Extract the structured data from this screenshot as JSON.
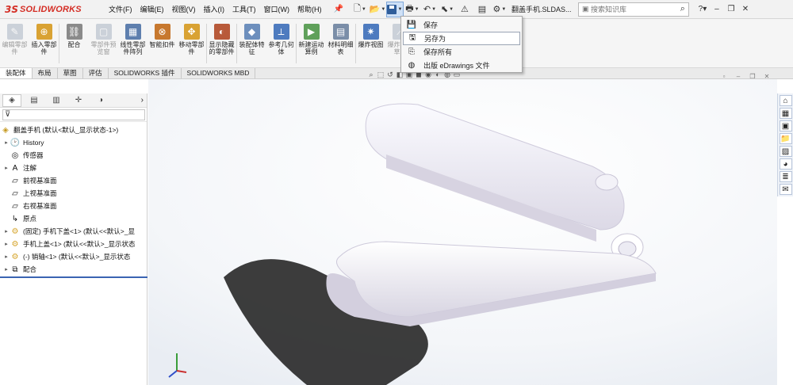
{
  "app": {
    "logo_mark": "3S",
    "logo_text": "SOLIDWORKS"
  },
  "menu": [
    "文件(F)",
    "编辑(E)",
    "视图(V)",
    "插入(I)",
    "工具(T)",
    "窗口(W)",
    "帮助(H)"
  ],
  "document_title": "翻盖手机.SLDAS...",
  "search": {
    "placeholder": "搜索知识库"
  },
  "ribbon": [
    {
      "label": "编辑零部件",
      "enabled": false,
      "icon": "edit-component-icon",
      "color": "#9aa7b8"
    },
    {
      "label": "插入零部件",
      "enabled": true,
      "icon": "insert-component-icon",
      "color": "#d9a233"
    },
    {
      "label": "配合",
      "enabled": true,
      "icon": "mate-icon",
      "color": "#8a8a8a"
    },
    {
      "label": "零部件预览窗",
      "enabled": false,
      "icon": "component-preview-icon",
      "color": "#9aa7b8"
    },
    {
      "label": "线性零部件阵列",
      "enabled": true,
      "icon": "linear-pattern-icon",
      "color": "#5e7fae"
    },
    {
      "label": "智能扣件",
      "enabled": true,
      "icon": "smart-fastener-icon",
      "color": "#c7782e"
    },
    {
      "label": "移动零部件",
      "enabled": true,
      "icon": "move-component-icon",
      "color": "#d9a233"
    },
    {
      "label": "显示隐藏的零部件",
      "enabled": true,
      "icon": "show-hidden-icon",
      "color": "#b85a3a"
    },
    {
      "label": "装配体特征",
      "enabled": true,
      "icon": "assembly-feature-icon",
      "color": "#6d8fbd"
    },
    {
      "label": "参考几何体",
      "enabled": true,
      "icon": "reference-geometry-icon",
      "color": "#4e7bbf"
    },
    {
      "label": "新建运动算例",
      "enabled": true,
      "icon": "motion-study-icon",
      "color": "#5fa05a"
    },
    {
      "label": "材料明细表",
      "enabled": true,
      "icon": "bom-icon",
      "color": "#7b8ea8"
    },
    {
      "label": "爆炸视图",
      "enabled": true,
      "icon": "exploded-view-icon",
      "color": "#4e7bbf"
    },
    {
      "label": "爆炸直线草图",
      "enabled": false,
      "icon": "explode-line-icon",
      "color": "#9aa7b8"
    }
  ],
  "cm_tabs": [
    "装配体",
    "布局",
    "草图",
    "评估",
    "SOLIDWORKS 插件",
    "SOLIDWORKS MBD"
  ],
  "save_menu": [
    {
      "label": "保存",
      "icon": "save-icon",
      "highlight": false
    },
    {
      "label": "另存为",
      "icon": "save-as-icon",
      "highlight": true
    },
    {
      "label": "保存所有",
      "icon": "save-all-icon",
      "highlight": false
    },
    {
      "label": "出版 eDrawings 文件",
      "icon": "edrawings-icon",
      "highlight": false
    }
  ],
  "tree": {
    "root": "翻盖手机 (默认<默认_显示状态-1>)",
    "items": [
      {
        "label": "History",
        "expandable": true,
        "icon": "history-icon"
      },
      {
        "label": "传感器",
        "expandable": false,
        "icon": "sensor-icon"
      },
      {
        "label": "注解",
        "expandable": true,
        "icon": "annotation-icon"
      },
      {
        "label": "前视基准面",
        "expandable": false,
        "icon": "plane-icon"
      },
      {
        "label": "上视基准面",
        "expandable": false,
        "icon": "plane-icon"
      },
      {
        "label": "右视基准面",
        "expandable": false,
        "icon": "plane-icon"
      },
      {
        "label": "原点",
        "expandable": false,
        "icon": "origin-icon"
      },
      {
        "label": "(固定) 手机下盖<1> (默认<<默认>_显",
        "expandable": true,
        "icon": "part-icon"
      },
      {
        "label": "手机上盖<1> (默认<<默认>_显示状态",
        "expandable": true,
        "icon": "part-icon"
      },
      {
        "label": "(-) 销轴<1> (默认<<默认>_显示状态",
        "expandable": true,
        "icon": "part-icon"
      },
      {
        "label": "配合",
        "expandable": true,
        "icon": "mates-folder-icon"
      }
    ]
  },
  "colors": {
    "accent": "#3a64b2",
    "brand": "#d42d24"
  }
}
